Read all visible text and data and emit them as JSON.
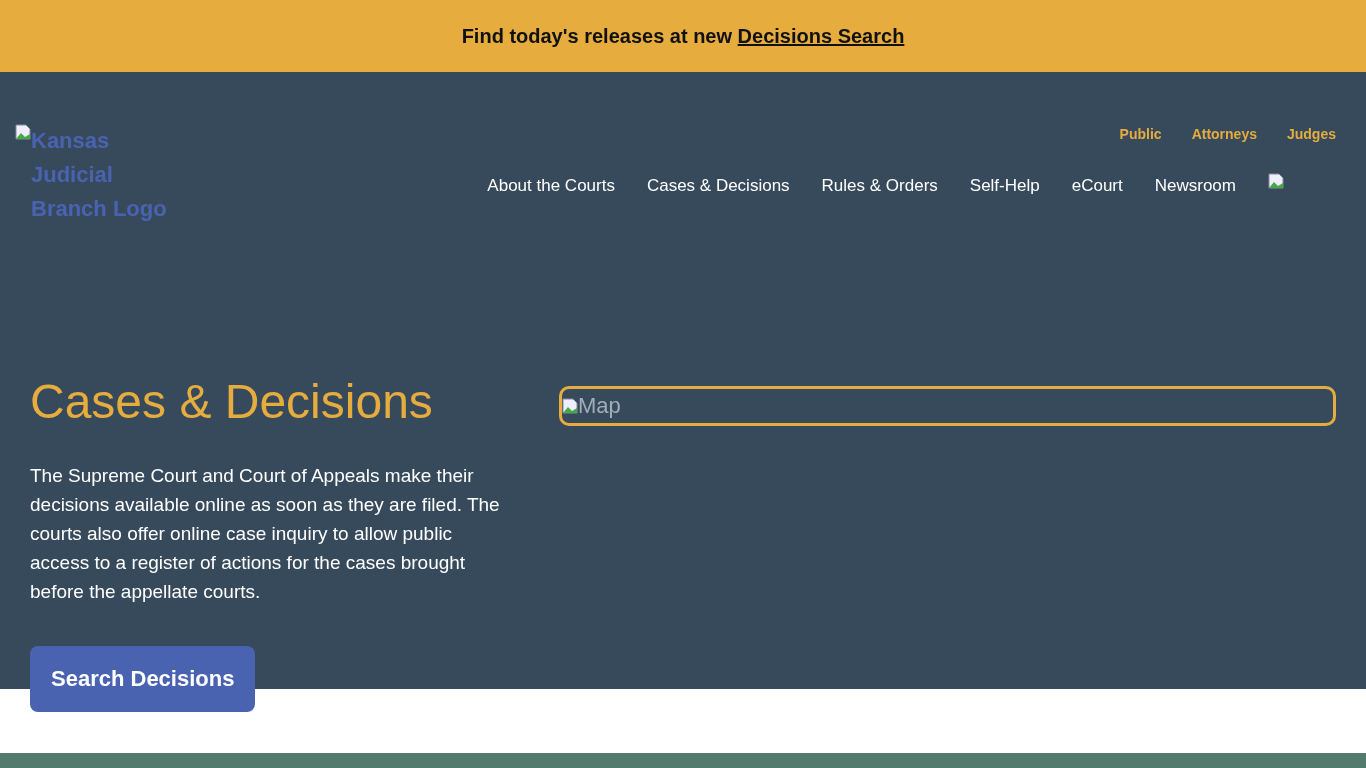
{
  "banner": {
    "text": "Find today's releases at new ",
    "link": "Decisions Search"
  },
  "logo": {
    "alt": "Kansas Judicial Branch Logo"
  },
  "audience_links": [
    "Public",
    "Attorneys",
    "Judges"
  ],
  "nav": [
    "About the Courts",
    "Cases & Decisions",
    "Rules & Orders",
    "Self-Help",
    "eCourt",
    "Newsroom"
  ],
  "hero": {
    "title": "Cases & Decisions",
    "body": "The Supreme Court and Court of Appeals make their decisions available online as soon as they are filed. The courts also offer online case inquiry to allow public access to a register of actions for the cases brought before the appellate courts.",
    "button": "Search Decisions",
    "map_alt": "Map"
  }
}
